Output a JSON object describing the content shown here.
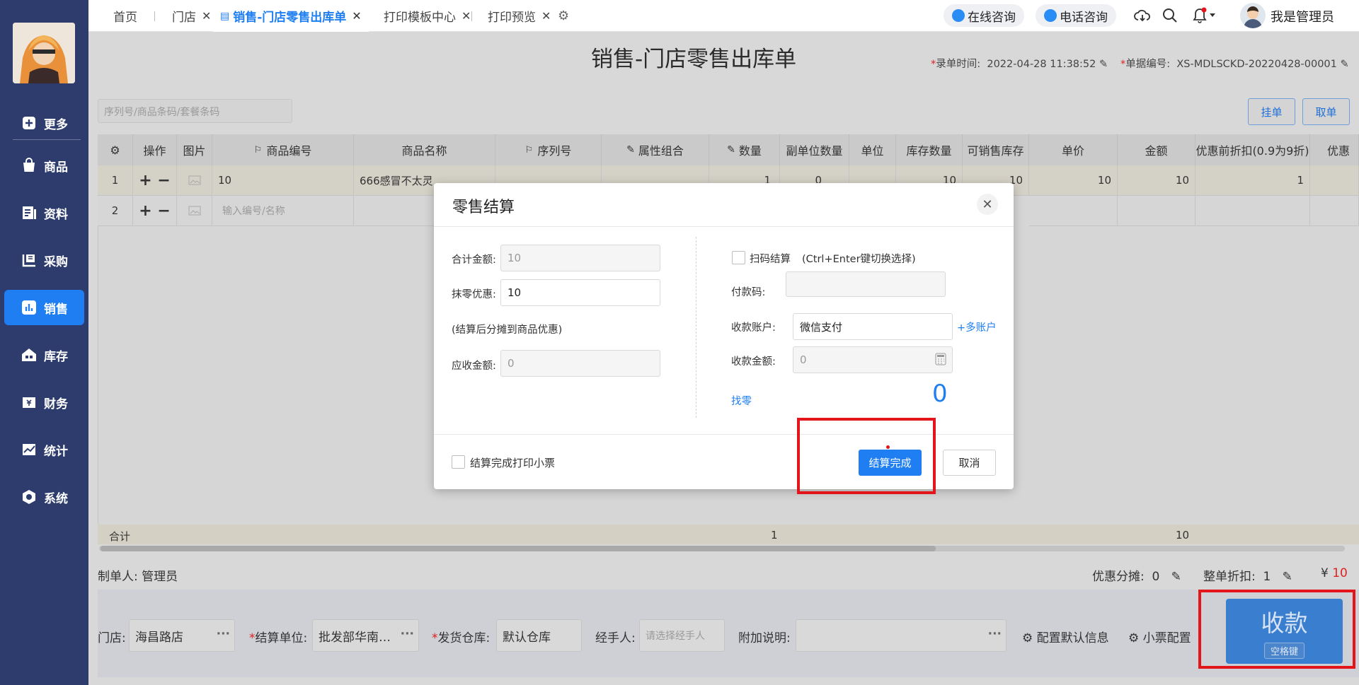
{
  "sidebar": {
    "items": [
      {
        "label": "更多",
        "icon": "plus-square-icon"
      },
      {
        "label": "商品",
        "icon": "shopping-bag-icon"
      },
      {
        "label": "资料",
        "icon": "document-icon"
      },
      {
        "label": "采购",
        "icon": "purchase-icon"
      },
      {
        "label": "销售",
        "icon": "bar-chart-icon"
      },
      {
        "label": "库存",
        "icon": "warehouse-icon"
      },
      {
        "label": "财务",
        "icon": "finance-icon"
      },
      {
        "label": "统计",
        "icon": "stats-icon"
      },
      {
        "label": "系统",
        "icon": "hexagon-icon"
      }
    ],
    "active_index": 4
  },
  "tabs": [
    {
      "label": "首页"
    },
    {
      "label": "门店"
    },
    {
      "label": "销售-门店零售出库单"
    },
    {
      "label": "打印模板中心"
    },
    {
      "label": "打印预览"
    }
  ],
  "topbar": {
    "online_consult": "在线咨询",
    "phone_consult": "电话咨询",
    "user_name": "我是管理员"
  },
  "document": {
    "title": "销售-门店零售出库单",
    "entry_time_label": "录单时间:",
    "entry_time": "2022-04-28 11:38:52",
    "doc_no_label": "单据编号:",
    "doc_no": "XS-MDLSCKD-20220428-00001",
    "search_placeholder": "序列号/商品条码/套餐条码",
    "hang_button": "挂单",
    "fetch_button": "取单"
  },
  "table": {
    "headers": [
      "操作",
      "图片",
      "商品编号",
      "商品名称",
      "序列号",
      "属性组合",
      "数量",
      "副单位数量",
      "单位",
      "库存数量",
      "可销售库存",
      "单价",
      "金额",
      "优惠前折扣(0.9为9折)",
      "优惠"
    ],
    "rows": [
      {
        "index": "1",
        "code": "10",
        "name": "666感冒不太灵",
        "qty": "1",
        "sub_qty": "0",
        "stock": "10",
        "sellable": "10",
        "price": "10",
        "amount": "10",
        "discount": "1"
      },
      {
        "index": "2",
        "code_placeholder": "输入编号/名称"
      }
    ],
    "summary": {
      "label": "合计",
      "qty": "1",
      "amount": "10"
    }
  },
  "footer": {
    "maker_label": "制单人:",
    "maker": "管理员",
    "discount_share_label": "优惠分摊:",
    "discount_share": "0",
    "whole_discount_label": "整单折扣:",
    "whole_discount": "1",
    "currency": "¥",
    "total": "10",
    "store_label": "门店:",
    "store": "海昌路店",
    "settle_unit_label": "结算单位:",
    "settle_unit": "批发部华南…",
    "warehouse_label": "发货仓库:",
    "warehouse": "默认仓库",
    "handler_label": "经手人:",
    "handler_placeholder": "请选择经手人",
    "remark_label": "附加说明:",
    "config_default": "配置默认信息",
    "receipt_config": "小票配置",
    "pay_button": "收款",
    "pay_hint": "空格键"
  },
  "modal": {
    "title": "零售结算",
    "total_label": "合计金额:",
    "total_value": "10",
    "round_label": "抹零优惠:",
    "round_value": "10",
    "round_note": "(结算后分摊到商品优惠)",
    "receivable_label": "应收金额:",
    "receivable_value": "0",
    "scan_label": "扫码结算",
    "scan_hint": "(Ctrl+Enter键切换选择)",
    "pay_code_label": "付款码:",
    "account_label": "收款账户:",
    "account_value": "微信支付",
    "multi_account": "+多账户",
    "amount_label": "收款金额:",
    "amount_value": "0",
    "change_label": "找零",
    "change_value": "0",
    "print_receipt": "结算完成打印小票",
    "finish_button": "结算完成",
    "cancel_button": "取消"
  }
}
